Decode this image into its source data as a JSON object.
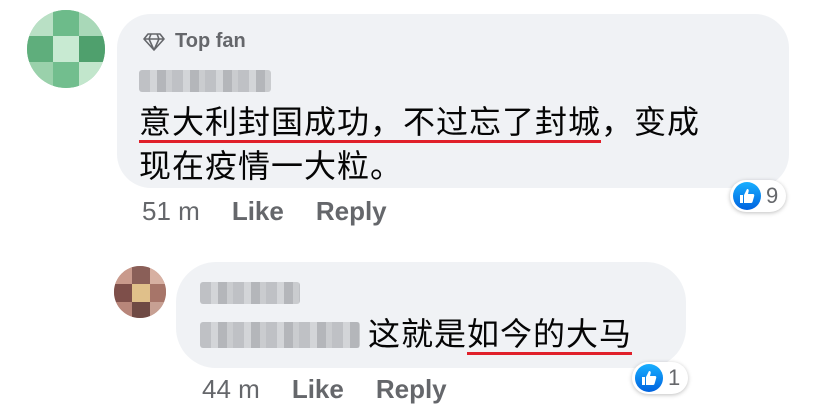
{
  "comment": {
    "badge_label": "Top fan",
    "badge_icon": "diamond-icon",
    "author_name": "",
    "text_part1_underlined": "意大利封国成功，不过忘了封城",
    "text_part2": "，变成",
    "text_line2": "现在疫情一大粒。",
    "time": "51 m",
    "like_label": "Like",
    "reply_label": "Reply",
    "reaction_count": "9"
  },
  "reply": {
    "author_name": "",
    "mentioned_name": "",
    "text_plain": "这就是",
    "text_underlined": "如今的大马",
    "time": "44 m",
    "like_label": "Like",
    "reply_label": "Reply",
    "reaction_count": "1"
  },
  "colors": {
    "bubble": "#f0f2f5",
    "meta_text": "#65676b",
    "underline": "#e0202a",
    "like_blue": "#1877f2"
  }
}
